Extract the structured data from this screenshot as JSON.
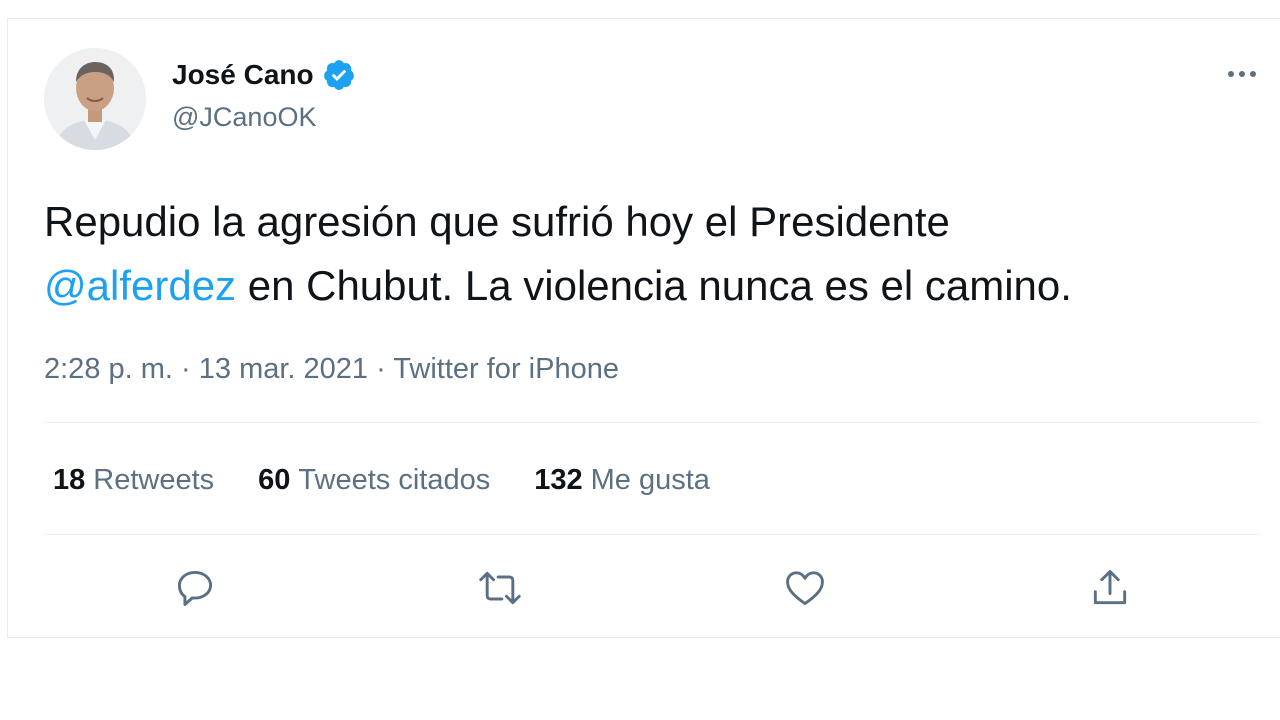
{
  "author": {
    "display_name": "José Cano",
    "handle": "@JCanoOK",
    "verified": true
  },
  "tweet": {
    "text_before": "Repudio la agresión que sufrió hoy el Presidente",
    "mention": "@alferdez",
    "text_after": " en Chubut. La violencia nunca es el camino."
  },
  "meta": {
    "time": "2:28 p. m.",
    "separator1": " · ",
    "date": "13 mar. 2021",
    "separator2": " · ",
    "source": "Twitter for iPhone"
  },
  "stats": [
    {
      "count": "18",
      "label": "Retweets"
    },
    {
      "count": "60",
      "label": "Tweets citados"
    },
    {
      "count": "132",
      "label": "Me gusta"
    }
  ],
  "actions": [
    "reply-icon",
    "retweet-icon",
    "like-icon",
    "share-icon"
  ],
  "colors": {
    "text": "#0f1419",
    "secondary": "#5b7083",
    "accent": "#1da1f2",
    "border": "#ebeef0"
  }
}
